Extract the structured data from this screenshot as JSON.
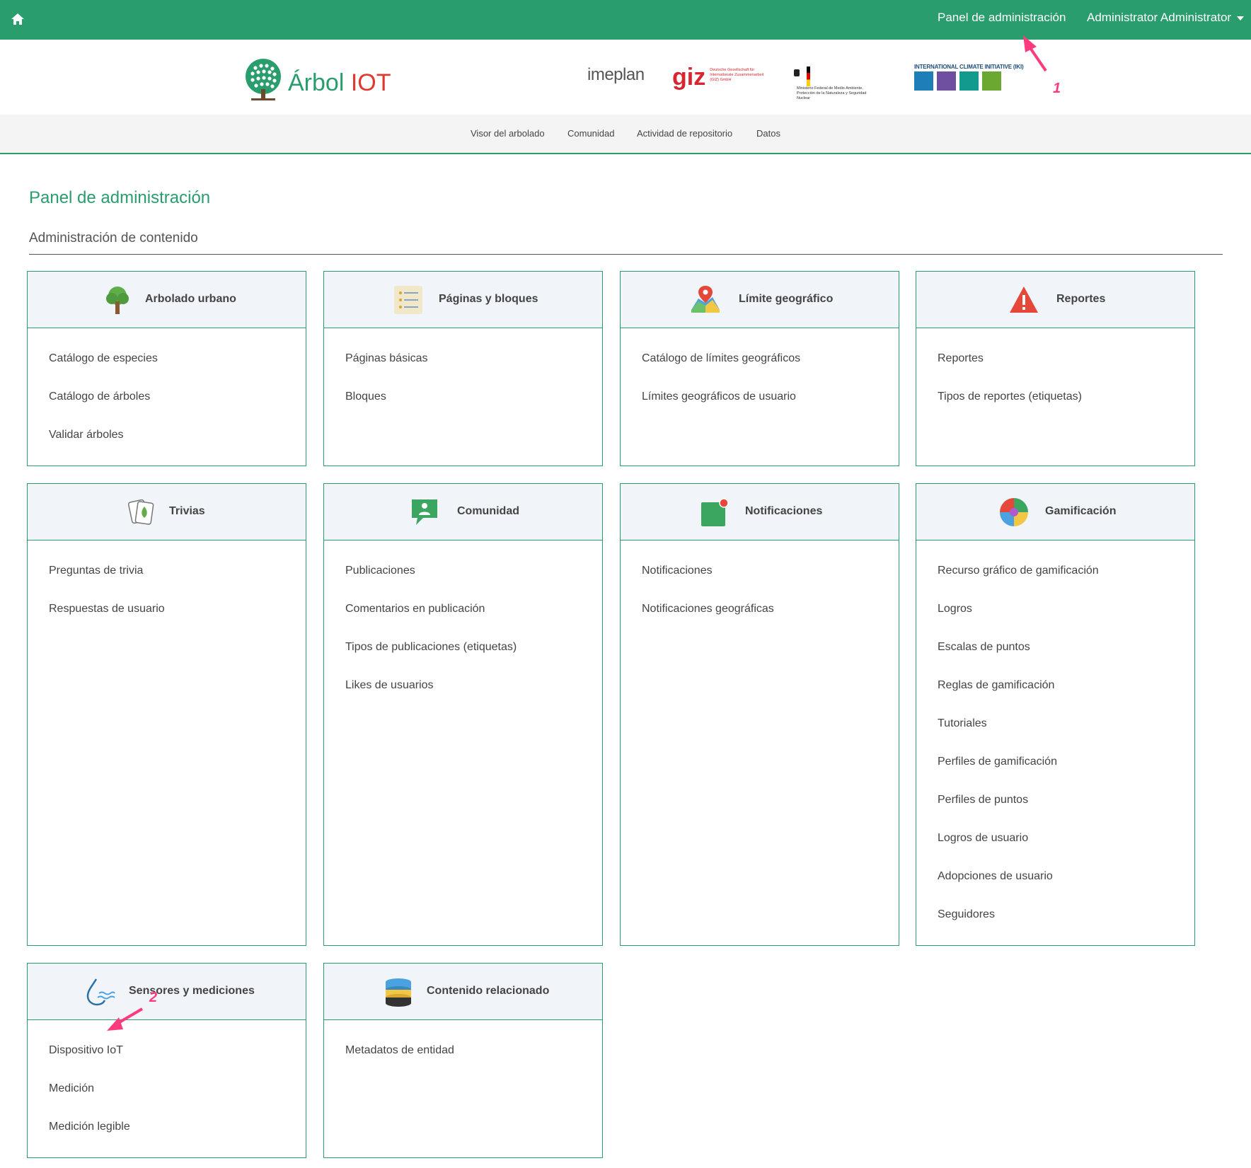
{
  "topbar": {
    "home_icon": "home-icon",
    "admin_link": "Panel de administración",
    "user_menu": "Administrator Administrator"
  },
  "brand": {
    "logo_text_main": "Árbol ",
    "logo_text_accent": "IOT",
    "partners": {
      "imeplan": "imeplan",
      "giz": "giz",
      "giz_sub": "Deutsche Gesellschaft für Internationale Zusammenarbeit (GIZ) GmbH",
      "bmu": "Ministerio Federal de Medio Ambiente, Protección de la Naturaleza y Seguridad Nuclear",
      "iki": "INTERNATIONAL CLIMATE INITIATIVE (IKI)"
    }
  },
  "nav": [
    "Visor del arbolado",
    "Comunidad",
    "Actividad de repositorio",
    "Datos"
  ],
  "page_title": "Panel de administración",
  "section_title": "Administración de contenido",
  "cards": [
    {
      "title": "Arbolado urbano",
      "icon": "tree-icon",
      "items": [
        "Catálogo de especies",
        "Catálogo de árboles",
        "Validar árboles"
      ]
    },
    {
      "title": "Páginas y bloques",
      "icon": "list-icon",
      "items": [
        "Páginas básicas",
        "Bloques"
      ]
    },
    {
      "title": "Límite geográfico",
      "icon": "map-pin-icon",
      "items": [
        "Catálogo de límites geográficos",
        "Límites geográficos de usuario"
      ]
    },
    {
      "title": "Reportes",
      "icon": "warning-icon",
      "items": [
        "Reportes",
        "Tipos de reportes (etiquetas)"
      ]
    },
    {
      "title": "Trivias",
      "icon": "cards-icon",
      "items": [
        "Preguntas de trivia",
        "Respuestas de usuario"
      ]
    },
    {
      "title": "Comunidad",
      "icon": "chat-user-icon",
      "items": [
        "Publicaciones",
        "Comentarios en publicación",
        "Tipos de publicaciones (etiquetas)",
        "Likes de usuarios"
      ]
    },
    {
      "title": "Notificaciones",
      "icon": "notification-icon",
      "items": [
        "Notificaciones",
        "Notificaciones geográficas"
      ]
    },
    {
      "title": "Gamificación",
      "icon": "puzzle-icon",
      "items": [
        "Recurso gráfico de gamificación",
        "Logros",
        "Escalas de puntos",
        "Reglas de gamificación",
        "Tutoriales",
        "Perfiles de gamificación",
        "Perfiles de puntos",
        "Logros de usuario",
        "Adopciones de usuario",
        "Seguidores"
      ]
    },
    {
      "title": "Sensores y mediciones",
      "icon": "water-drop-icon",
      "items": [
        "Dispositivo IoT",
        "Medición",
        "Medición legible"
      ]
    },
    {
      "title": "Contenido relacionado",
      "icon": "database-icon",
      "items": [
        "Metadatos de entidad"
      ]
    }
  ],
  "annotations": {
    "one": "1",
    "two": "2"
  }
}
